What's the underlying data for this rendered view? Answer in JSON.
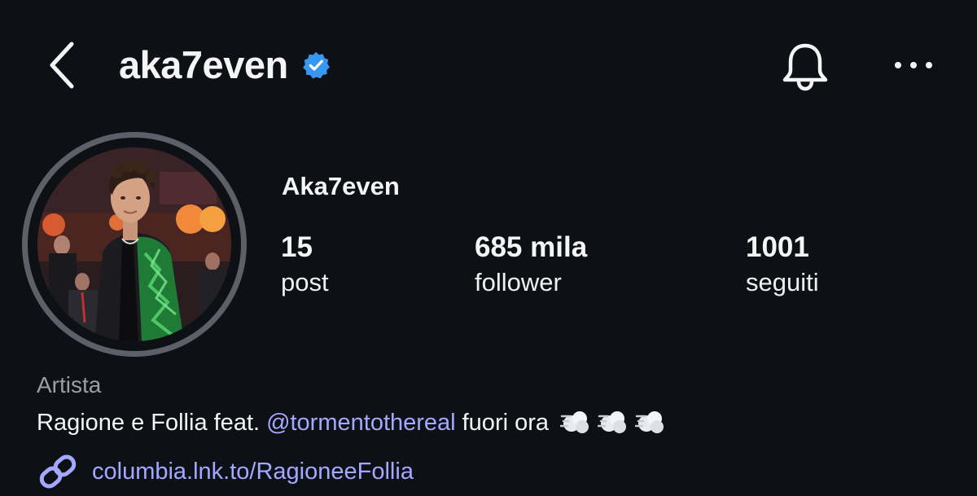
{
  "header": {
    "username": "aka7even",
    "back_icon": "chevron-left-icon",
    "verified_icon": "verified-badge-icon",
    "bell_icon": "bell-icon",
    "more_icon": "more-horizontal-icon"
  },
  "profile": {
    "display_name": "Aka7even",
    "stats": [
      {
        "value": "15",
        "label": "post"
      },
      {
        "value": "685 mila",
        "label": "follower"
      },
      {
        "value": "1001",
        "label": "seguiti"
      }
    ],
    "category": "Artista",
    "bio": {
      "text_before": "Ragione e Follia feat.",
      "mention": "@tormentothereal",
      "text_after": "fuori ora",
      "emoji": "dash-symbol-emoji"
    },
    "link": {
      "icon": "link-icon",
      "text": "columbia.lnk.to/RagioneeFollia"
    }
  },
  "colors": {
    "background": "#0d1015",
    "text": "#f5f5f5",
    "muted": "#9a9ea6",
    "link": "#a5a8ff",
    "verified": "#3897f0",
    "avatar_ring": "#5d6068"
  }
}
